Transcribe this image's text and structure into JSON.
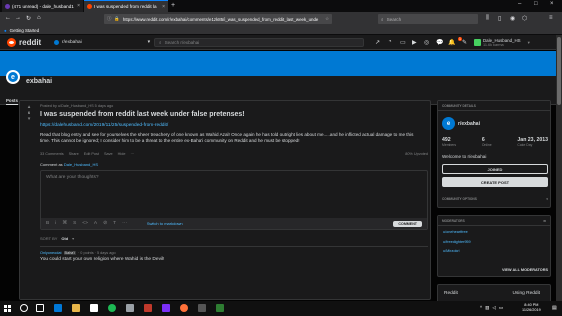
{
  "browser": {
    "tabs": [
      {
        "label": "(471 unread) - dale_husband1",
        "active": false
      },
      {
        "label": "I was suspended from reddit la",
        "active": true
      }
    ],
    "url": "https://www.reddit.com/r/exbahai/comments/e1zk85/i_was_suspended_from_reddit_last_week_unde",
    "search_placeholder": "Search",
    "bookmark": "Getting Started",
    "icons": {
      "back": "back-arrow-icon",
      "forward": "forward-arrow-icon",
      "reload": "reload-icon",
      "home": "home-icon"
    }
  },
  "reddit": {
    "wordmark": "reddit",
    "current_sub": "r/exbahai",
    "search_placeholder": "Search r/exbahai",
    "notification_count": "1",
    "user": {
      "name": "Dale_Husband_HS",
      "karma": "11.6k karma"
    }
  },
  "subreddit": {
    "icon_letter": "e",
    "title": "exbahai",
    "tab": "Posts"
  },
  "post": {
    "score": "6",
    "meta": "Posted by u/Dale_Husband_HS 5 days ago",
    "title": "I was suspended from reddit last week under false pretenses!",
    "link": "https://dalehusband.com/2019/11/25/suspended-from-reddit/",
    "text": "Read that blog entry and see for yourselves the sheer treachery of one known as Wahid Azal! Once again he has told outright lies about me.....and he inflicted actual damage to me this time. This cannot be ignored; I consider him to be a threat to the entire ex-Baha'i community on Reddit and he must be stopped!",
    "actions": {
      "comments": "33 Comments",
      "share": "Share",
      "edit": "Edit Post",
      "save": "Save",
      "hide": "Hide",
      "more": "···",
      "upvoted": "80% Upvoted"
    },
    "comment_as": "Comment as",
    "comment_user": "Dale_Husband_HS",
    "comment_placeholder": "What are your thoughts?",
    "toolbar": [
      "B",
      "i",
      "⌘",
      "S",
      "<>",
      "A",
      "⊘",
      "T",
      "⋯",
      "≡",
      "☰",
      "❝",
      "⊞"
    ],
    "markdown": "Switch to markdown",
    "comment_button": "COMMENT",
    "sort_label": "SORT BY",
    "sort_value": "Old",
    "first_comment": {
      "user": "Onlyoneodat",
      "flair": "Baha'i",
      "meta": "· 0 points · 5 days ago",
      "text": "You could start your own religion where Wahid is the Devil!"
    }
  },
  "sidebar": {
    "community_header": "COMMUNITY DETAILS",
    "community_name": "r/exbahai",
    "stats": [
      {
        "n": "492",
        "l": "Members"
      },
      {
        "n": "6",
        "l": "Online"
      },
      {
        "n": "Jan 23, 2013",
        "l": "Cake Day"
      }
    ],
    "welcome": "Welcome to r/exbahai",
    "join": "JOINED",
    "create": "CREATE POST",
    "options": "COMMUNITY OPTIONS",
    "mods_header": "MODERATORS",
    "mods": [
      "u/oneheartfree",
      "u/freedighter959",
      "u/Mirzokri"
    ],
    "all_mods": "VIEW ALL MODERATORS",
    "footer": [
      "Reddit",
      "Using Reddit"
    ]
  },
  "taskbar": {
    "time": "8:40 PM",
    "date": "11/26/2019"
  },
  "colors": {
    "accent": "#0079d3",
    "brand": "#ff4500",
    "background": "#030303",
    "card": "#1a1a1b"
  }
}
